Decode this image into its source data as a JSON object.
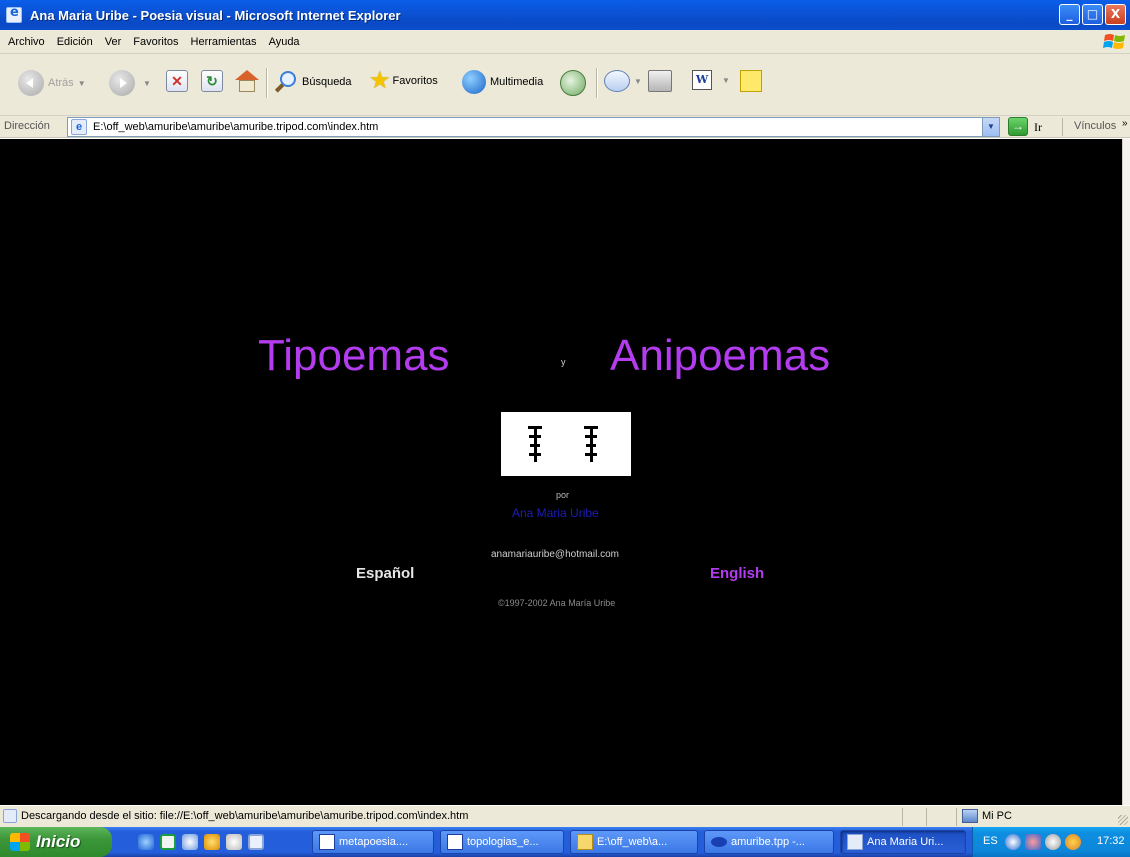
{
  "window": {
    "title": "Ana Maria Uribe - Poesia visual - Microsoft Internet Explorer",
    "minimize": "_",
    "maximize": "□",
    "close": "X"
  },
  "menu": [
    "Archivo",
    "Edición",
    "Ver",
    "Favoritos",
    "Herramientas",
    "Ayuda"
  ],
  "toolbar": {
    "back_label": "Atrás",
    "search_label": "Búsqueda",
    "favorites_label": "Favoritos",
    "media_label": "Multimedia",
    "word_label": "W"
  },
  "address": {
    "label": "Dirección",
    "value": "E:\\off_web\\amuribe\\amuribe\\amuribe.tripod.com\\index.htm",
    "go_label": "Ir",
    "links_label": "Vínculos",
    "links_more": "»"
  },
  "page": {
    "title_left": "Tipoemas",
    "title_joiner": "y",
    "title_right": "Anipoemas",
    "by": "por",
    "author": "Ana Maria Uribe",
    "email": "anamariauribe@hotmail.com",
    "lang_es": "Español",
    "lang_en": "English",
    "copyright": "©1997-2002 Ana María Uribe",
    "accent_color": "#b43cf0",
    "background_color": "#000000"
  },
  "status": {
    "text": "Descargando desde el sitio: file://E:\\off_web\\amuribe\\amuribe\\amuribe.tripod.com\\index.htm",
    "zone": "Mi PC"
  },
  "taskbar": {
    "start_label": "Inicio",
    "tasks": [
      {
        "label": "metapoesia....",
        "icon": "word-doc-icon"
      },
      {
        "label": "topologias_e...",
        "icon": "word-doc-icon"
      },
      {
        "label": "E:\\off_web\\a...",
        "icon": "folder-icon"
      },
      {
        "label": "amuribe.tpp -...",
        "icon": "app-icon"
      },
      {
        "label": "Ana Maria Uri...",
        "icon": "ie-icon"
      }
    ],
    "language": "ES",
    "clock": "17:32"
  }
}
